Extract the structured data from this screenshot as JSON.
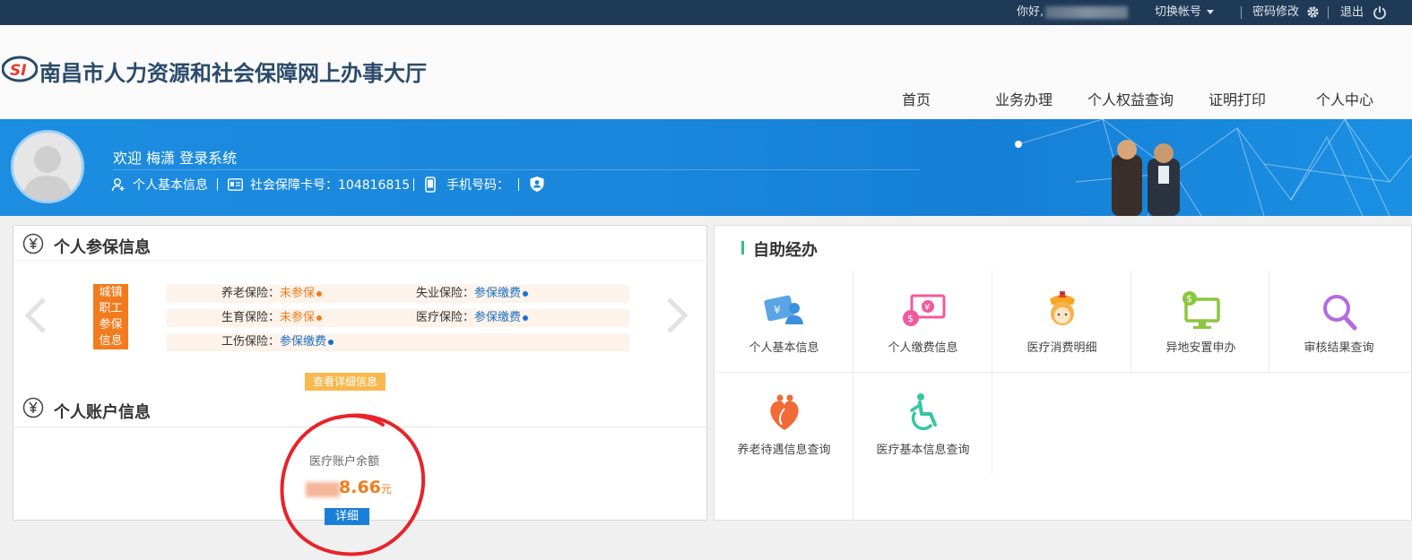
{
  "topbar": {
    "greeting": "你好,",
    "switch_account": "切换帐号",
    "change_password": "密码修改",
    "logout": "退出"
  },
  "header": {
    "site_title": "南昌市人力资源和社会保障网上办事大厅",
    "logo_text": "SI",
    "nav": [
      "首页",
      "业务办理",
      "个人权益查询",
      "证明打印",
      "个人中心"
    ]
  },
  "banner": {
    "welcome": "欢迎 梅潇 登录系统",
    "personal_info": "个人基本信息",
    "card_label": "社会保障卡号：104816815",
    "phone_label": "手机号码："
  },
  "insurance": {
    "title": "个人参保信息",
    "badge": [
      "城镇",
      "职工",
      "参保",
      "信息"
    ],
    "rows": [
      [
        {
          "label": "养老保险：",
          "status": "未参保",
          "kind": "no"
        },
        {
          "label": "失业保险：",
          "status": "参保缴费",
          "kind": "yes"
        }
      ],
      [
        {
          "label": "生育保险：",
          "status": "未参保",
          "kind": "no"
        },
        {
          "label": "医疗保险：",
          "status": "参保缴费",
          "kind": "yes"
        }
      ],
      [
        {
          "label": "工伤保险：",
          "status": "参保缴费",
          "kind": "yes"
        }
      ]
    ],
    "view_details": "查看详细信息"
  },
  "account": {
    "title": "个人账户信息",
    "balance_label": "医疗账户余额",
    "balance_visible": "8.66",
    "unit": "元",
    "detail": "详细"
  },
  "selfservice": {
    "title": "自助经办",
    "tiles": [
      {
        "label": "个人基本信息",
        "icon": "id-card-icon"
      },
      {
        "label": "个人缴费信息",
        "icon": "payment-icon"
      },
      {
        "label": "医疗消费明细",
        "icon": "nurse-icon"
      },
      {
        "label": "异地安置申办",
        "icon": "monitor-dollar-icon"
      },
      {
        "label": "审核结果查询",
        "icon": "magnifier-icon"
      },
      {
        "label": "养老待遇信息查询",
        "icon": "heart-hands-icon"
      },
      {
        "label": "医疗基本信息查询",
        "icon": "wheelchair-icon"
      }
    ]
  },
  "colors": {
    "topbar": "#1f3a57",
    "banner": "#1a86dc",
    "orange": "#f37b1d",
    "blue_status": "#1b6fc4",
    "green_accent": "#2cc185",
    "annotation_red": "#e8232a"
  }
}
